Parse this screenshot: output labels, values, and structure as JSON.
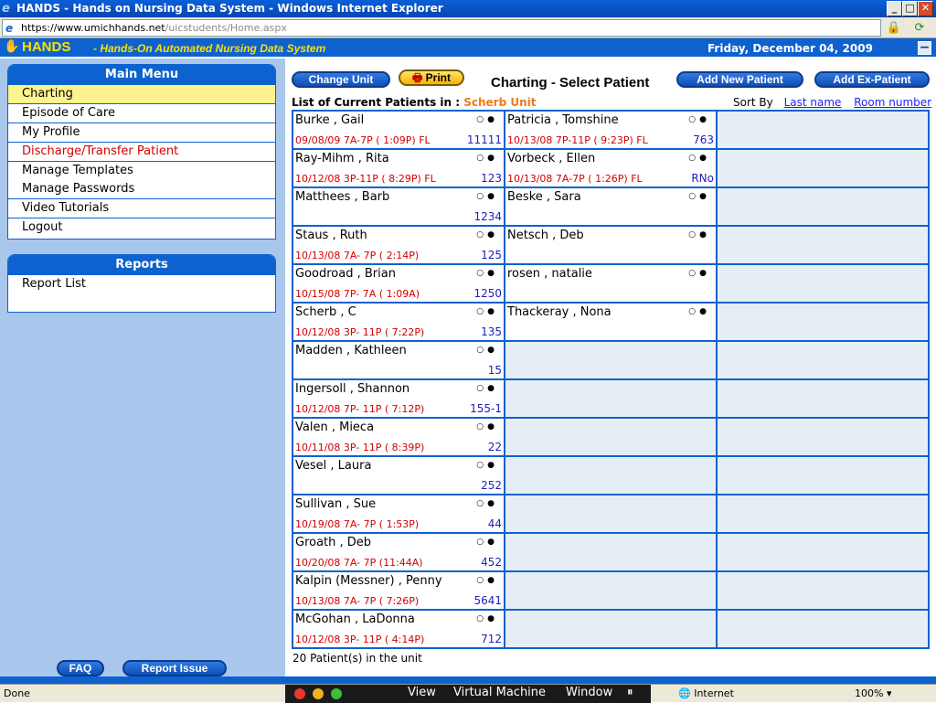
{
  "window": {
    "title": "HANDS - Hands on Nursing Data System - Windows Internet Explorer",
    "url_host": "https://www.umichhands.net",
    "url_path": "/uicstudents/Home.aspx"
  },
  "header": {
    "brand": "HANDS",
    "subtitle": "- Hands-On Automated Nursing Data System",
    "date": "Friday, December 04, 2009"
  },
  "main_menu": {
    "title": "Main Menu",
    "items": [
      "Charting",
      "Episode of Care",
      "My Profile",
      "Discharge/Transfer Patient",
      "Manage Templates",
      "Manage Passwords",
      "Video Tutorials",
      "Logout"
    ]
  },
  "reports": {
    "title": "Reports",
    "items": [
      "Report List"
    ]
  },
  "sidebar_buttons": {
    "faq": "FAQ",
    "report_issue": "Report Issue"
  },
  "toolbar": {
    "change_unit": "Change Unit",
    "print": "Print",
    "heading": "Charting - Select Patient",
    "add_new": "Add New Patient",
    "add_ex": "Add Ex-Patient"
  },
  "list": {
    "label": "List of Current Patients in :",
    "unit": "Scherb Unit",
    "sort_by": "Sort By",
    "sort_last": "Last name",
    "sort_room": "Room number",
    "count": "20 Patient(s) in the unit"
  },
  "patients_col1": [
    {
      "name": "Burke , Gail",
      "shift": "09/08/09 7A-7P ( 1:09P) FL",
      "room": "11111"
    },
    {
      "name": "Ray-Mihm , Rita",
      "shift": "10/12/08 3P-11P ( 8:29P) FL",
      "room": "123"
    },
    {
      "name": "Matthees , Barb",
      "shift": "",
      "room": "1234"
    },
    {
      "name": "Staus , Ruth",
      "shift": "10/13/08 7A- 7P ( 2:14P)",
      "room": "125"
    },
    {
      "name": "Goodroad , Brian",
      "shift": "10/15/08 7P- 7A ( 1:09A)",
      "room": "1250"
    },
    {
      "name": "Scherb , C",
      "shift": "10/12/08 3P- 11P ( 7:22P)",
      "room": "135"
    },
    {
      "name": "Madden , Kathleen",
      "shift": "",
      "room": "15"
    },
    {
      "name": "Ingersoll , Shannon",
      "shift": "10/12/08 7P- 11P ( 7:12P)",
      "room": "155-1"
    },
    {
      "name": "Valen , Mieca",
      "shift": "10/11/08 3P- 11P ( 8:39P)",
      "room": "22"
    },
    {
      "name": "Vesel , Laura",
      "shift": "",
      "room": "252"
    },
    {
      "name": "Sullivan , Sue",
      "shift": "10/19/08 7A- 7P ( 1:53P)",
      "room": "44"
    },
    {
      "name": "Groath , Deb",
      "shift": "10/20/08 7A- 7P (11:44A)",
      "room": "452"
    },
    {
      "name": "Kalpin (Messner) , Penny",
      "shift": "10/13/08 7A- 7P ( 7:26P)",
      "room": "5641"
    },
    {
      "name": "McGohan , LaDonna",
      "shift": "10/12/08 3P- 11P ( 4:14P)",
      "room": "712"
    }
  ],
  "patients_col2": [
    {
      "name": "Patricia , Tomshine",
      "shift": "10/13/08 7P-11P ( 9:23P) FL",
      "room": "763"
    },
    {
      "name": "Vorbeck , Ellen",
      "shift": "10/13/08 7A-7P ( 1:26P) FL",
      "room": "RNo"
    },
    {
      "name": "Beske , Sara",
      "shift": "",
      "room": ""
    },
    {
      "name": "Netsch , Deb",
      "shift": "",
      "room": ""
    },
    {
      "name": "rosen , natalie",
      "shift": "",
      "room": ""
    },
    {
      "name": "Thackeray , Nona",
      "shift": "",
      "room": ""
    }
  ],
  "statusbar": {
    "done": "Done",
    "vm_view": "View",
    "vm_machine": "Virtual Machine",
    "vm_window": "Window",
    "zone": "Internet",
    "zoom": "100%"
  },
  "colors": {
    "accent": "#0d62cf",
    "active_menu": "#fff38f",
    "warning_text": "#d40000",
    "unit_text": "#ef7a1a"
  }
}
